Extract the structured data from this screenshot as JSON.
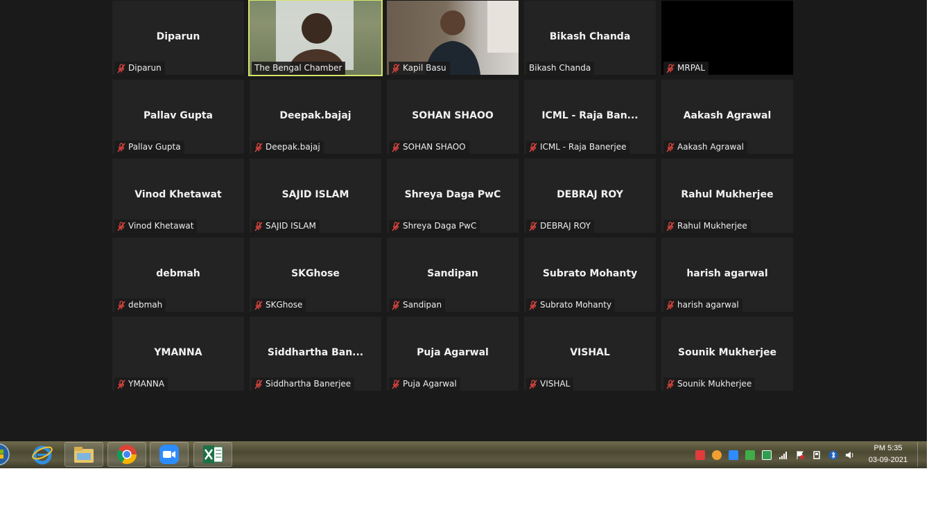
{
  "participants": [
    {
      "display": "Diparun",
      "label": "Diparun",
      "muted": true,
      "video": false
    },
    {
      "display": "",
      "label": "The Bengal Chamber",
      "muted": false,
      "video": true,
      "active": true
    },
    {
      "display": "",
      "label": "Kapil Basu",
      "muted": true,
      "video": true
    },
    {
      "display": "Bikash Chanda",
      "label": "Bikash Chanda",
      "muted": false,
      "video": false
    },
    {
      "display": "",
      "label": "MRPAL",
      "muted": true,
      "video": false,
      "black": true
    },
    {
      "display": "Pallav Gupta",
      "label": "Pallav Gupta",
      "muted": true,
      "video": false
    },
    {
      "display": "Deepak.bajaj",
      "label": "Deepak.bajaj",
      "muted": true,
      "video": false
    },
    {
      "display": "SOHAN SHAOO",
      "label": "SOHAN SHAOO",
      "muted": true,
      "video": false
    },
    {
      "display": "ICML - Raja Ban...",
      "label": "ICML - Raja Banerjee",
      "muted": true,
      "video": false
    },
    {
      "display": "Aakash Agrawal",
      "label": "Aakash Agrawal",
      "muted": true,
      "video": false
    },
    {
      "display": "Vinod Khetawat",
      "label": "Vinod Khetawat",
      "muted": true,
      "video": false
    },
    {
      "display": "SAJID ISLAM",
      "label": "SAJID ISLAM",
      "muted": true,
      "video": false
    },
    {
      "display": "Shreya Daga PwC",
      "label": "Shreya Daga PwC",
      "muted": true,
      "video": false
    },
    {
      "display": "DEBRAJ ROY",
      "label": "DEBRAJ ROY",
      "muted": true,
      "video": false
    },
    {
      "display": "Rahul Mukherjee",
      "label": "Rahul Mukherjee",
      "muted": true,
      "video": false
    },
    {
      "display": "debmah",
      "label": "debmah",
      "muted": true,
      "video": false
    },
    {
      "display": "SKGhose",
      "label": "SKGhose",
      "muted": true,
      "video": false
    },
    {
      "display": "Sandipan",
      "label": "Sandipan",
      "muted": true,
      "video": false
    },
    {
      "display": "Subrato Mohanty",
      "label": "Subrato Mohanty",
      "muted": true,
      "video": false
    },
    {
      "display": "harish agarwal",
      "label": "harish agarwal",
      "muted": true,
      "video": false
    },
    {
      "display": "YMANNA",
      "label": "YMANNA",
      "muted": true,
      "video": false
    },
    {
      "display": "Siddhartha  Ban...",
      "label": "Siddhartha Banerjee",
      "muted": true,
      "video": false
    },
    {
      "display": "Puja Agarwal",
      "label": "Puja Agarwal",
      "muted": true,
      "video": false
    },
    {
      "display": "VISHAL",
      "label": "VISHAL",
      "muted": true,
      "video": false
    },
    {
      "display": "Sounik Mukherjee",
      "label": "Sounik Mukherjee",
      "muted": true,
      "video": false
    }
  ],
  "taskbar": {
    "apps": [
      {
        "name": "start-orb-icon"
      },
      {
        "name": "internet-explorer-icon"
      },
      {
        "name": "file-explorer-icon"
      },
      {
        "name": "chrome-icon"
      },
      {
        "name": "zoom-icon"
      },
      {
        "name": "excel-icon"
      }
    ],
    "clock": {
      "time": "PM 5:35",
      "date": "03-09-2021"
    }
  },
  "colors": {
    "meeting_bg": "#1a1a1a",
    "tile_bg": "#232323",
    "active_speaker_border": "#d8e56a",
    "mute_icon": "#e0463f"
  }
}
